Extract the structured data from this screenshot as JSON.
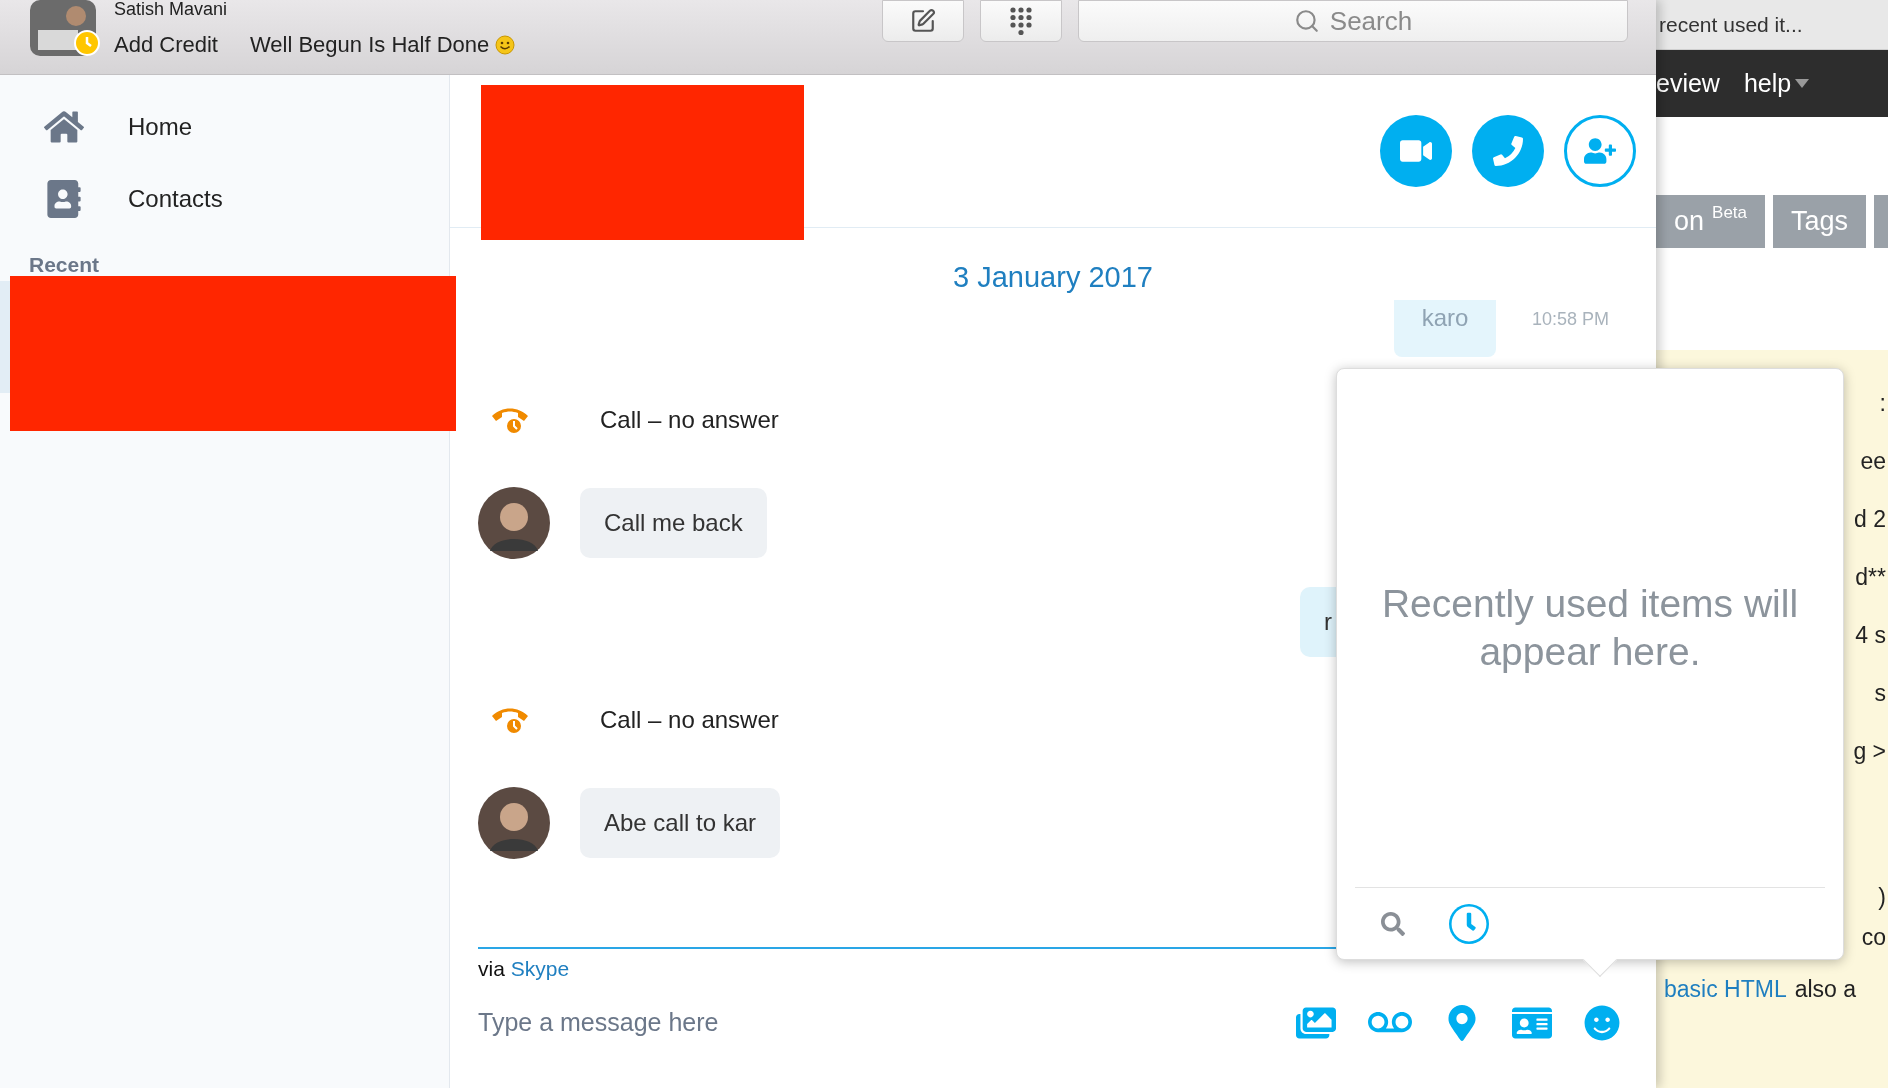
{
  "profile": {
    "name": "Satish Mavani",
    "credit_link": "Add Credit",
    "mood": "Well Begun Is Half Done"
  },
  "search": {
    "placeholder": "Search"
  },
  "sidebar": {
    "items": [
      {
        "label": "Home"
      },
      {
        "label": "Contacts"
      }
    ],
    "section": "Recent"
  },
  "conversation": {
    "date": "3 January 2017",
    "faded_message": {
      "text": "karo",
      "time": "10:58 PM"
    },
    "messages": [
      {
        "kind": "call",
        "text": "Call – no answer"
      },
      {
        "kind": "incoming",
        "text": "Call me back"
      },
      {
        "kind": "outgoing",
        "text": "r"
      },
      {
        "kind": "call",
        "text": "Call – no answer"
      },
      {
        "kind": "incoming",
        "text": "Abe call to kar"
      }
    ]
  },
  "composer": {
    "via": "via",
    "service": "Skype",
    "placeholder": "Type a message here"
  },
  "popup": {
    "message": "Recently used items will appear here.",
    "tabs": [
      {
        "kind": "search",
        "selected": false
      },
      {
        "kind": "recent",
        "selected": true
      }
    ]
  },
  "browser": {
    "tab": "recent used it...",
    "menu": [
      "eview",
      "help"
    ],
    "buttons": [
      {
        "label": "on$^{Beta}$"
      },
      {
        "label": "Tags"
      }
    ],
    "fragments": [
      ":",
      "ee",
      "d 2",
      "d**",
      "4 s",
      "s",
      "g >"
    ],
    "fragments_lower": [
      ")",
      "co"
    ],
    "link_line": {
      "link": "basic HTML",
      "text": "also a"
    }
  }
}
